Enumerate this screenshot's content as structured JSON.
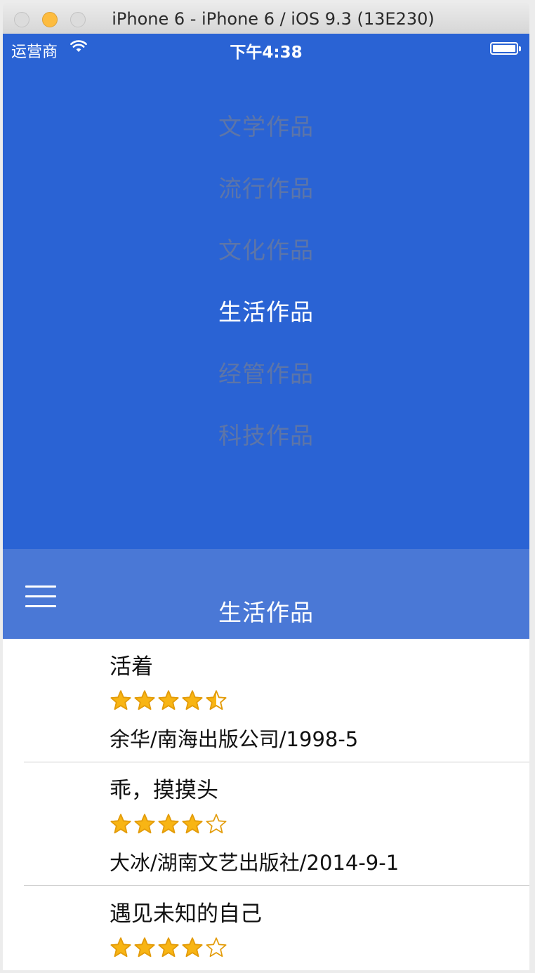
{
  "window": {
    "title": "iPhone 6 - iPhone 6 / iOS 9.3 (13E230)"
  },
  "status_bar": {
    "carrier": "运营商",
    "time": "下午4:38"
  },
  "categories": [
    {
      "label": "文学作品",
      "active": false
    },
    {
      "label": "流行作品",
      "active": false
    },
    {
      "label": "文化作品",
      "active": false
    },
    {
      "label": "生活作品",
      "active": true
    },
    {
      "label": "经管作品",
      "active": false
    },
    {
      "label": "科技作品",
      "active": false
    }
  ],
  "navbar": {
    "title": "生活作品",
    "menu_icon": "hamburger-menu-icon"
  },
  "books": [
    {
      "title": "活着",
      "rating": 4.5,
      "meta": "余华/南海出版公司/1998-5"
    },
    {
      "title": "乖，摸摸头",
      "rating": 4,
      "meta": "大冰/湖南文艺出版社/2014-9-1"
    },
    {
      "title": "遇见未知的自己",
      "rating": 4,
      "meta": ""
    }
  ],
  "colors": {
    "menu_background": "#2a63d4",
    "navbar_background": "#4a78d6",
    "inactive_category": "#5d75a8",
    "star_fill": "#f8b514",
    "star_stroke": "#e39c0a"
  }
}
